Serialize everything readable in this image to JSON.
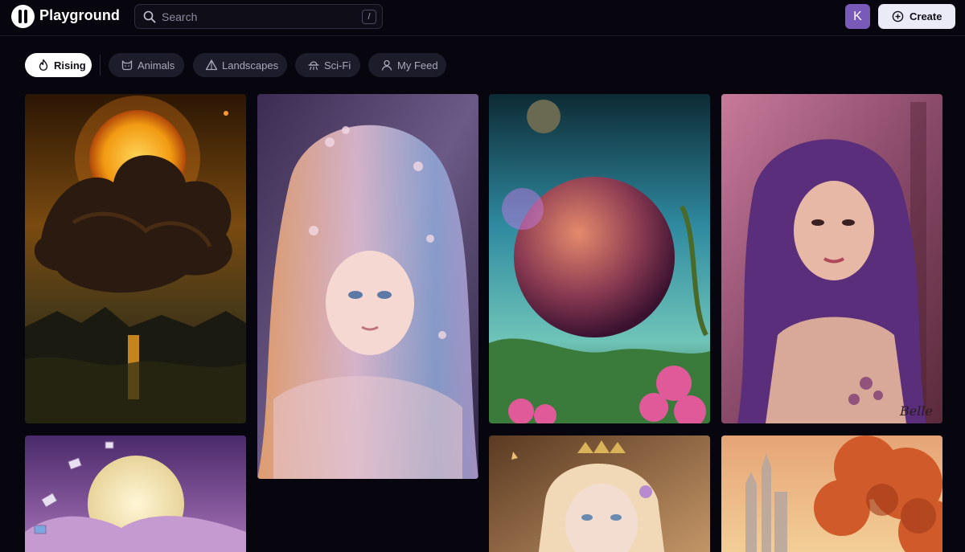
{
  "app": {
    "title": "Playground"
  },
  "search": {
    "placeholder": "Search",
    "shortcut": "/"
  },
  "user": {
    "avatar_initial": "K"
  },
  "actions": {
    "create_label": "Create"
  },
  "filters": [
    {
      "label": "Rising",
      "icon": "flame-icon",
      "active": true
    },
    {
      "label": "Animals",
      "icon": "cat-icon",
      "active": false
    },
    {
      "label": "Landscapes",
      "icon": "triangle-icon",
      "active": false
    },
    {
      "label": "Sci-Fi",
      "icon": "ufo-icon",
      "active": false
    },
    {
      "label": "My Feed",
      "icon": "user-icon",
      "active": false
    }
  ],
  "gallery": [
    {
      "subject": "eclipse-over-lake",
      "signature": ""
    },
    {
      "subject": "pastel-haired-woman",
      "signature": ""
    },
    {
      "subject": "planet-over-garden",
      "signature": ""
    },
    {
      "subject": "purple-haired-woman",
      "signature": "Belle"
    },
    {
      "subject": "moon-with-cards",
      "signature": ""
    },
    {
      "subject": "blonde-princess",
      "signature": ""
    },
    {
      "subject": "castle-in-autumn-forest",
      "signature": ""
    }
  ],
  "colors": {
    "background": "#07060f",
    "chip": "#1d1c2a",
    "chip_active": "#ffffff",
    "avatar": "#7a5ab8",
    "create_button": "#ebeaf7"
  }
}
